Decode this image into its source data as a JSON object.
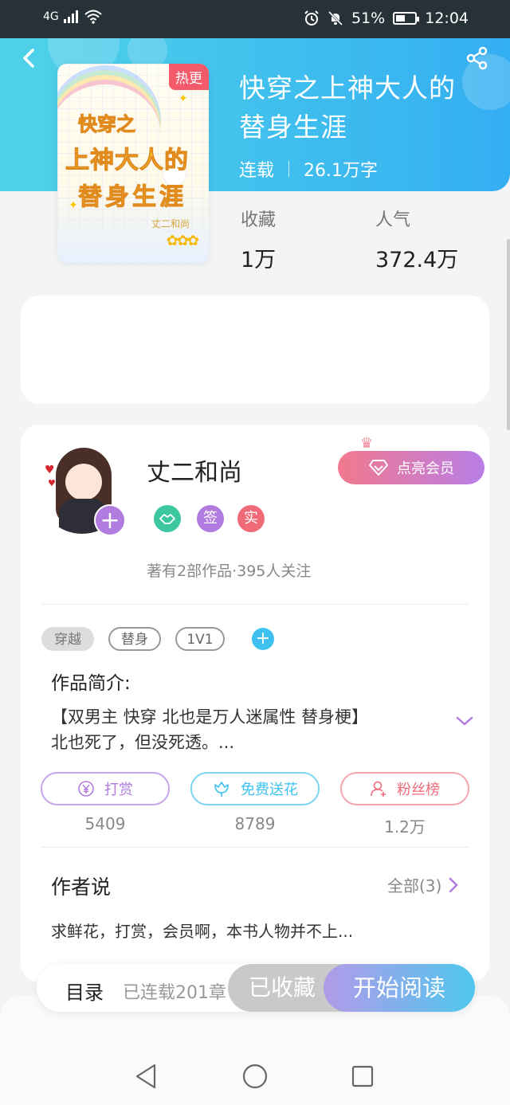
{
  "status_bar": {
    "network": "4G",
    "battery": "51%",
    "battery_level": 0.51,
    "time": "12:04"
  },
  "book": {
    "cover": {
      "hot_badge": "热更",
      "line1": "快穿之",
      "line2": "上神大人的",
      "line3": "替身生涯",
      "author_sign": "丈二和尚"
    },
    "title": "快穿之上神大人的替身生涯",
    "status": "连载",
    "word_count": "26.1万字",
    "stats": [
      {
        "label": "收藏",
        "value": "1万"
      },
      {
        "label": "人气",
        "value": "372.4万"
      }
    ]
  },
  "author": {
    "name": "丈二和尚",
    "vip_button": "点亮会员",
    "badges": [
      {
        "icon": "handshake-icon",
        "text": "",
        "color": "#3cc7a0"
      },
      {
        "icon": "signed-icon",
        "text": "签",
        "color": "#b27be0"
      },
      {
        "icon": "verified-icon",
        "text": "实",
        "color": "#f06a78"
      }
    ],
    "summary": "著有2部作品·395人关注"
  },
  "tags": [
    "穿越",
    "替身",
    "1V1"
  ],
  "intro": {
    "title": "作品简介:",
    "line1": "【双男主 快穿 北也是万人迷属性 替身梗】",
    "line2": "北也死了，但没死透。..."
  },
  "actions": [
    {
      "label": "打赏",
      "count": "5409",
      "icon": "yen-icon",
      "color": "#b27be0"
    },
    {
      "label": "免费送花",
      "count": "8789",
      "icon": "flower-icon",
      "color": "#3ec1ef"
    },
    {
      "label": "粉丝榜",
      "count": "1.2万",
      "icon": "user-icon",
      "color": "#f06a78"
    }
  ],
  "author_say": {
    "title": "作者说",
    "all_link": "全部(3)",
    "text": "求鲜花，打赏，会员啊，本书人物并不上..."
  },
  "bottom_bar": {
    "toc": "目录",
    "toc_status": "已连载201章",
    "collected": "已收藏",
    "read": "开始阅读"
  },
  "colors": {
    "header_start": "#4fd3e8",
    "header_end": "#34aef2",
    "vip_start": "#f2798e",
    "vip_end": "#b87ee6"
  }
}
